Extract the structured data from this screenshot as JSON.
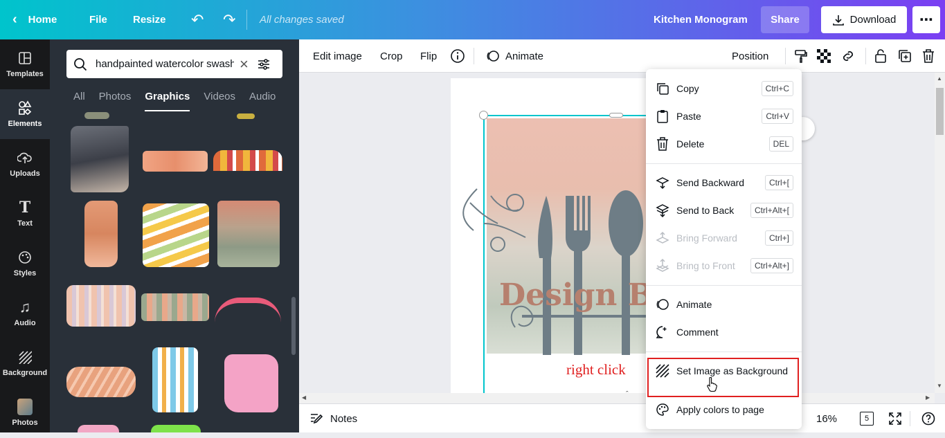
{
  "topbar": {
    "home": "Home",
    "file": "File",
    "resize": "Resize",
    "saved": "All changes saved",
    "title": "Kitchen Monogram",
    "share": "Share",
    "download": "Download"
  },
  "rail": [
    {
      "label": "Templates",
      "icon": "templates-icon"
    },
    {
      "label": "Elements",
      "icon": "elements-icon"
    },
    {
      "label": "Uploads",
      "icon": "uploads-icon"
    },
    {
      "label": "Text",
      "icon": "text-icon"
    },
    {
      "label": "Styles",
      "icon": "styles-icon"
    },
    {
      "label": "Audio",
      "icon": "audio-icon"
    },
    {
      "label": "Background",
      "icon": "background-icon"
    },
    {
      "label": "Photos",
      "icon": "photos-icon"
    }
  ],
  "panel": {
    "search_value": "handpainted watercolor swash",
    "tabs": [
      "All",
      "Photos",
      "Graphics",
      "Videos",
      "Audio"
    ],
    "active_tab": "Graphics"
  },
  "toolbar": {
    "edit_image": "Edit image",
    "crop": "Crop",
    "flip": "Flip",
    "animate": "Animate",
    "position": "Position"
  },
  "canvas": {
    "design_text": "Design Bu"
  },
  "context_menu": {
    "items": [
      {
        "label": "Copy",
        "shortcut": "Ctrl+C",
        "icon": "copy-icon",
        "disabled": false
      },
      {
        "label": "Paste",
        "shortcut": "Ctrl+V",
        "icon": "paste-icon",
        "disabled": false
      },
      {
        "label": "Delete",
        "shortcut": "DEL",
        "icon": "trash-icon",
        "disabled": false
      },
      {
        "label": "Send Backward",
        "shortcut": "Ctrl+[",
        "icon": "send-backward-icon",
        "disabled": false
      },
      {
        "label": "Send to Back",
        "shortcut": "Ctrl+Alt+[",
        "icon": "send-to-back-icon",
        "disabled": false
      },
      {
        "label": "Bring Forward",
        "shortcut": "Ctrl+]",
        "icon": "bring-forward-icon",
        "disabled": true
      },
      {
        "label": "Bring to Front",
        "shortcut": "Ctrl+Alt+]",
        "icon": "bring-to-front-icon",
        "disabled": true
      },
      {
        "label": "Animate",
        "shortcut": "",
        "icon": "animate-icon",
        "disabled": false
      },
      {
        "label": "Comment",
        "shortcut": "",
        "icon": "comment-icon",
        "disabled": false
      },
      {
        "label": "Set Image as Background",
        "shortcut": "",
        "icon": "background-icon",
        "disabled": false
      },
      {
        "label": "Apply colors to page",
        "shortcut": "",
        "icon": "palette-icon",
        "disabled": false
      }
    ]
  },
  "annotation": "right click",
  "bottombar": {
    "notes": "Notes",
    "zoom": "16%",
    "page_count": "5"
  },
  "colors": {
    "accent_red": "#e02020",
    "panel_bg": "#293039",
    "rail_bg": "#18191b"
  }
}
